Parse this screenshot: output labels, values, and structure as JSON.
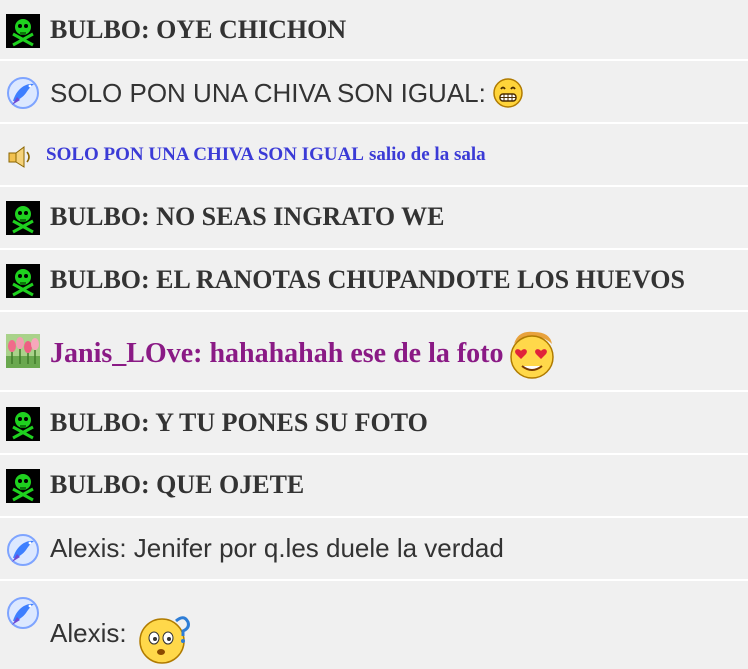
{
  "messages": [
    {
      "text": "BULBO: OYE CHICHON"
    },
    {
      "text": "SOLO PON UNA CHIVA SON IGUAL:",
      "emote": "grin-emoticon"
    },
    {
      "text": "SOLO PON UNA CHIVA SON IGUAL",
      "text2": "salio de la sala"
    },
    {
      "text": "BULBO: NO SEAS INGRATO WE"
    },
    {
      "text": "BULBO: EL RANOTAS CHUPANDOTE LOS HUEVOS"
    },
    {
      "text": "Janis_LOve: hahahahah ese de la foto",
      "emote": "love-emoticon"
    },
    {
      "text": "BULBO: Y TU PONES SU FOTO"
    },
    {
      "text": "BULBO: QUE OJETE"
    },
    {
      "text": "Alexis: Jenifer por q.les duele la verdad"
    },
    {
      "text": "Alexis:",
      "emote": "confused-emoticon"
    }
  ],
  "colors": {
    "background": "#f0f0f0",
    "separator": "#ffffff",
    "default_text": "#333333",
    "system_text": "#3b3bd6",
    "janis_text": "#8a1a85"
  },
  "icons": [
    "skull-crossbones-icon",
    "dolphin-icon",
    "speaker-icon",
    "tulips-avatar-icon"
  ]
}
